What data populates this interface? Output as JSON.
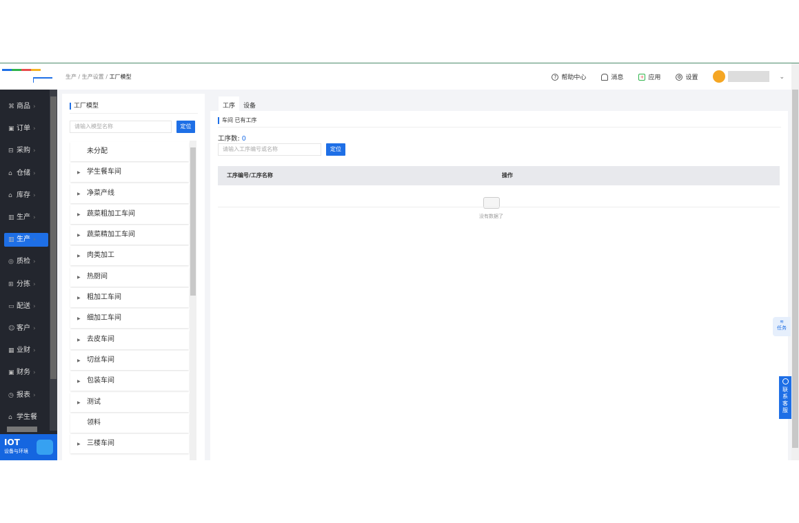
{
  "breadcrumb": [
    "生产",
    "生产设置",
    "工厂模型"
  ],
  "header": {
    "help": "帮助中心",
    "messages": "消息",
    "apps": "应用",
    "settings": "设置"
  },
  "sidebar": {
    "items": [
      {
        "label": "商品",
        "icon": "grid-icon"
      },
      {
        "label": "订单",
        "icon": "clipboard-icon"
      },
      {
        "label": "采购",
        "icon": "basket-icon"
      },
      {
        "label": "仓储",
        "icon": "warehouse-icon"
      },
      {
        "label": "库存",
        "icon": "warehouse-icon"
      },
      {
        "label": "生产",
        "icon": "factory-icon"
      },
      {
        "label": "生产",
        "icon": "factory-icon",
        "active": true
      },
      {
        "label": "质检",
        "icon": "shield-icon"
      },
      {
        "label": "分拣",
        "icon": "sort-icon"
      },
      {
        "label": "配送",
        "icon": "truck-icon"
      },
      {
        "label": "客户",
        "icon": "user-icon"
      },
      {
        "label": "业财",
        "icon": "chart-icon"
      },
      {
        "label": "财务",
        "icon": "finance-icon"
      },
      {
        "label": "报表",
        "icon": "clock-icon"
      },
      {
        "label": "学生餐",
        "icon": "home-icon"
      }
    ],
    "iot_title": "IOT",
    "iot_subtitle": "设备与环境"
  },
  "left_panel": {
    "title": "工厂模型",
    "search_placeholder": "请输入模型名称",
    "locate": "定位",
    "nodes": [
      {
        "label": "未分配",
        "expandable": false
      },
      {
        "label": "学生餐车间",
        "expandable": true
      },
      {
        "label": "净菜产线",
        "expandable": true
      },
      {
        "label": "蔬菜粗加工车间",
        "expandable": true
      },
      {
        "label": "蔬菜精加工车间",
        "expandable": true
      },
      {
        "label": "肉类加工",
        "expandable": true
      },
      {
        "label": "热厨间",
        "expandable": true
      },
      {
        "label": "粗加工车间",
        "expandable": true
      },
      {
        "label": "细加工车间",
        "expandable": true
      },
      {
        "label": "去皮车间",
        "expandable": true
      },
      {
        "label": "切丝车间",
        "expandable": true
      },
      {
        "label": "包装车间",
        "expandable": true
      },
      {
        "label": "测试",
        "expandable": true
      },
      {
        "label": "领料",
        "expandable": false
      },
      {
        "label": "三楼车间",
        "expandable": true
      }
    ]
  },
  "main": {
    "tabs": [
      "工序",
      "设备"
    ],
    "section_title": "车间 已有工序",
    "count_label": "工序数:",
    "count": "0",
    "search_placeholder": "请输入工序编号或名称",
    "locate": "定位",
    "columns": [
      "工序编号/工序名称",
      "操作"
    ],
    "empty_text": "没有数据了"
  },
  "floating": {
    "task": "任务",
    "customer_service": [
      "联",
      "系",
      "客",
      "服"
    ]
  }
}
